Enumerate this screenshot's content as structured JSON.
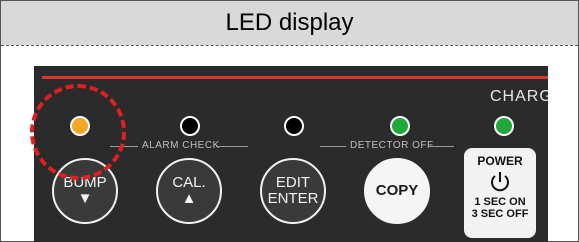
{
  "header": {
    "title": "LED display"
  },
  "panel": {
    "charge_label": "CHARGE",
    "group_labels": {
      "alarm_check": "ALARM CHECK",
      "detector_off": "DETECTOR OFF"
    },
    "leds": [
      {
        "name": "bump",
        "color": "#f5a623"
      },
      {
        "name": "cal",
        "color": "#000000"
      },
      {
        "name": "edit",
        "color": "#000000"
      },
      {
        "name": "copy",
        "color": "#1fa83a"
      },
      {
        "name": "power",
        "color": "#1fa83a"
      }
    ],
    "buttons": {
      "bump": {
        "label": "BUMP",
        "arrow": "▼"
      },
      "cal": {
        "label": "CAL.",
        "arrow": "▲"
      },
      "edit": {
        "line1": "EDIT",
        "line2": "ENTER"
      },
      "copy": {
        "label": "COPY"
      },
      "power": {
        "label": "POWER",
        "line1": "1 SEC ON",
        "line2": "3 SEC OFF"
      }
    },
    "accent_colors": {
      "red_line": "#d63a2f",
      "highlight": "#e02020"
    }
  }
}
